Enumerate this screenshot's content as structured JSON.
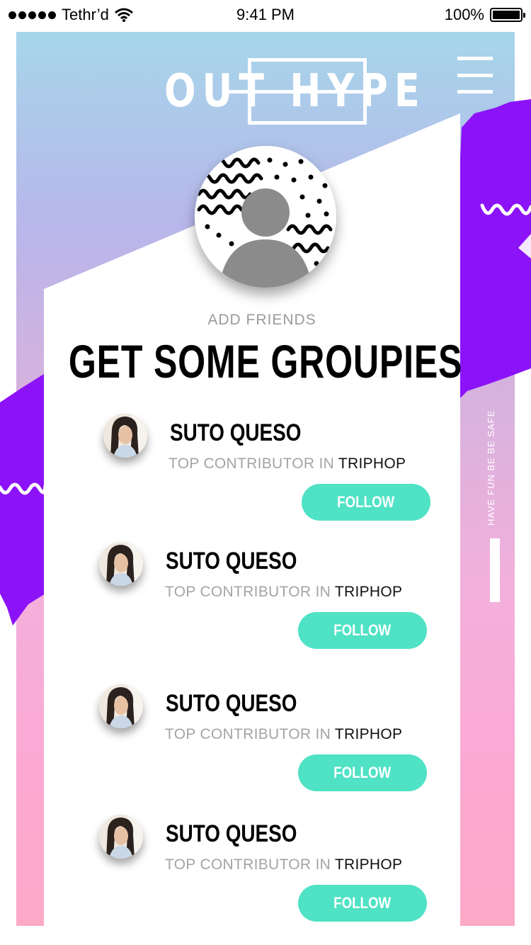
{
  "status_bar": {
    "carrier": "Tethr’d",
    "time": "9:41 PM",
    "battery": "100%",
    "battery_level": 1.0
  },
  "header": {
    "logo_text": "OUT HYPE",
    "menu_icon": "hamburger-menu-icon"
  },
  "profile": {
    "avatar_icon": "user-placeholder-icon"
  },
  "section": {
    "subtitle": "ADD FRIENDS",
    "title": "GET SOME GROUPIES"
  },
  "side_text": "HAVE FUN BE BE SAFE",
  "friends": [
    {
      "name": "SUTO QUESO",
      "desc_prefix": "TOP CONTRIBUTOR IN",
      "genre": "TRIPHOP",
      "button": "FOLLOW"
    },
    {
      "name": "SUTO QUESO",
      "desc_prefix": "TOP CONTRIBUTOR IN",
      "genre": "TRIPHOP",
      "button": "FOLLOW"
    },
    {
      "name": "SUTO QUESO",
      "desc_prefix": "TOP CONTRIBUTOR IN",
      "genre": "TRIPHOP",
      "button": "FOLLOW"
    },
    {
      "name": "SUTO QUESO",
      "desc_prefix": "TOP CONTRIBUTOR IN",
      "genre": "TRIPHOP",
      "button": "FOLLOW"
    }
  ],
  "colors": {
    "accent": "#4fe2c5",
    "brush": "#8c12f8",
    "hero_top": "#a6d6ea",
    "hero_bottom": "#fda9c8"
  }
}
